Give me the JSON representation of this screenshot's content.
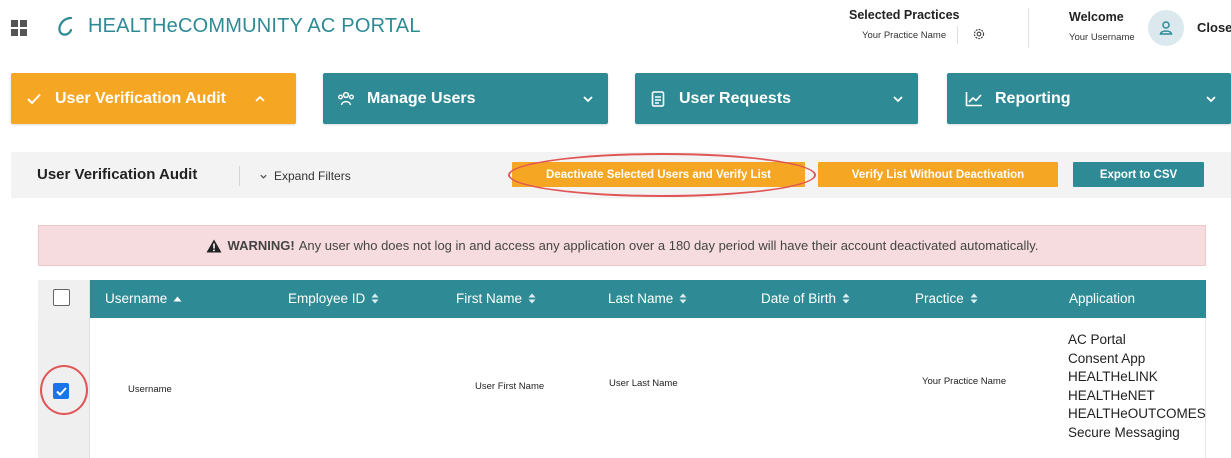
{
  "header": {
    "app_title": "HEALTHeCOMMUNITY AC PORTAL",
    "selected_practices_label": "Selected Practices",
    "selected_practice_value": "Your Practice Name",
    "welcome_label": "Welcome",
    "username": "Your Username",
    "close_label": "Close"
  },
  "nav": {
    "items": [
      {
        "label": "User Verification Audit",
        "icon": "check-icon",
        "state": "expanded"
      },
      {
        "label": "Manage Users",
        "icon": "users-icon",
        "state": "collapsed"
      },
      {
        "label": "User Requests",
        "icon": "document-icon",
        "state": "collapsed"
      },
      {
        "label": "Reporting",
        "icon": "chart-icon",
        "state": "collapsed"
      }
    ]
  },
  "toolbar": {
    "title": "User Verification Audit",
    "expand_filters": "Expand Filters",
    "deactivate_button": "Deactivate Selected Users and Verify List",
    "verify_button": "Verify List Without Deactivation",
    "export_button": "Export to CSV"
  },
  "warning": {
    "strong": "WARNING!",
    "message": "Any user who does not log in and access any application over a 180 day period will have their account deactivated automatically."
  },
  "table": {
    "columns": [
      "Username",
      "Employee ID",
      "First Name",
      "Last Name",
      "Date of Birth",
      "Practice",
      "Application"
    ],
    "rows": [
      {
        "checked": true,
        "username": "Username",
        "employee_id": "",
        "first_name": "User First Name",
        "last_name": "User Last Name",
        "date_of_birth": "",
        "practice": "Your Practice Name",
        "applications": [
          "AC Portal",
          "Consent App",
          "HEALTHeLINK",
          "HEALTHeNET",
          "HEALTHeOUTCOMES",
          "Secure Messaging"
        ]
      }
    ]
  },
  "colors": {
    "teal": "#2e8b95",
    "orange": "#f5a623",
    "warning_bg": "#f6dcde",
    "annotation_red": "#e05555",
    "checkbox_blue": "#1a73e8"
  }
}
